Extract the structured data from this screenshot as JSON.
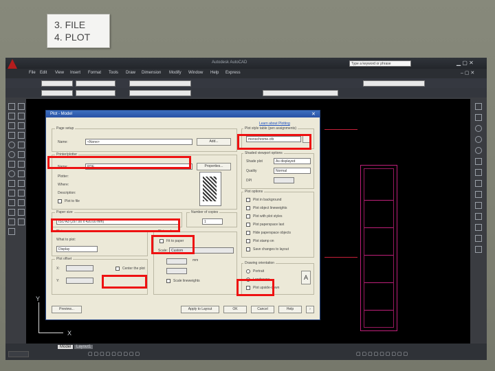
{
  "caption": {
    "lines": [
      "3. FILE",
      "4. PLOT"
    ]
  },
  "app": {
    "title": "Autodesk AutoCAD",
    "search_placeholder": "Type a keyword or phrase"
  },
  "menu": [
    "File",
    "Edit",
    "View",
    "Insert",
    "Format",
    "Tools",
    "Draw",
    "Dimension",
    "Modify",
    "Window",
    "Help",
    "Express"
  ],
  "dialog": {
    "title": "Plot - Model",
    "link": "Learn about Plotting",
    "page_setup": {
      "label": "Page setup",
      "name_label": "Name:",
      "name_value": "<None>",
      "add_button": "Add..."
    },
    "printer": {
      "label": "Printer/plotter",
      "name_label": "Name:",
      "name_value": "PDF",
      "properties_button": "Properties...",
      "plotter_label": "Plotter:",
      "where_label": "Where:",
      "desc_label": "Description:",
      "plot_to_file": "Plot to file"
    },
    "paper_size": {
      "label": "Paper size",
      "value": "ISO A3 (297.00 x 420.00 mm)"
    },
    "copies": {
      "label": "Number of copies",
      "value": "1"
    },
    "plot_area": {
      "label": "Plot area",
      "what_label": "What to plot:",
      "value": "Display"
    },
    "plot_offset": {
      "label": "Plot offset",
      "x_label": "X:",
      "y_label": "Y:",
      "center_label": "Center the plot"
    },
    "plot_scale": {
      "label": "Plot scale",
      "fit": "Fit to paper",
      "scale_label": "Scale:",
      "scale_value": "Custom",
      "unit": "mm",
      "scale_lineweights": "Scale lineweights"
    },
    "style_table": {
      "label": "Plot style table (pen assignments)",
      "value": "monochrome.ctb"
    },
    "shaded": {
      "label": "Shaded viewport options",
      "shade_label": "Shade plot",
      "shade_value": "As displayed",
      "quality_label": "Quality",
      "quality_value": "Normal",
      "dpi_label": "DPI"
    },
    "options": {
      "label": "Plot options",
      "items": [
        "Plot in background",
        "Plot object lineweights",
        "Plot with plot styles",
        "Plot paperspace last",
        "Hide paperspace objects",
        "Plot stamp on",
        "Save changes to layout"
      ]
    },
    "orientation": {
      "label": "Drawing orientation",
      "items": [
        "Portrait",
        "Landscape",
        "Plot upside-down"
      ]
    },
    "buttons": {
      "preview": "Preview...",
      "apply": "Apply to Layout",
      "ok": "OK",
      "cancel": "Cancel",
      "help": "Help"
    }
  },
  "ucs": {
    "x": "X",
    "y": "Y"
  },
  "tabs": [
    "Model",
    "Layout1"
  ]
}
